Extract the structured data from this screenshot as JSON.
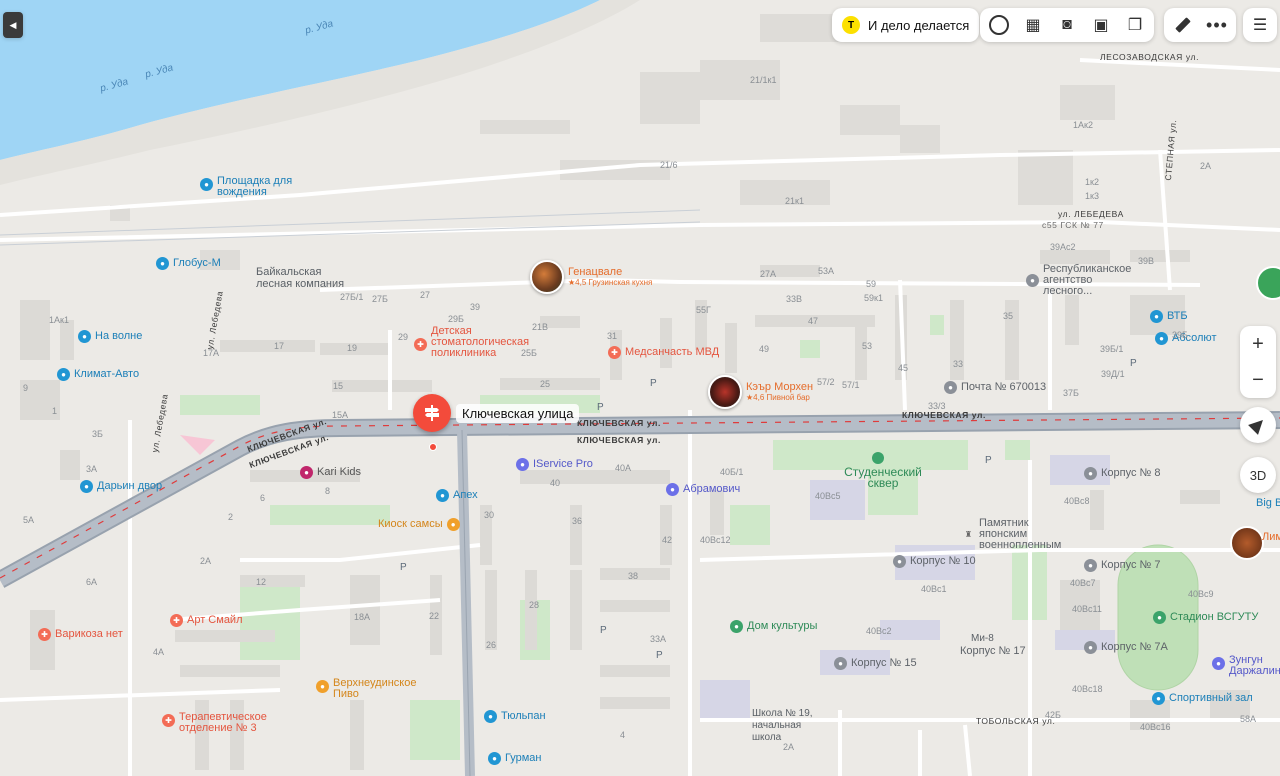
{
  "top_bar": {
    "promo_label": "И дело делается",
    "promo_icon": "taxi-logo-icon",
    "accent": "#fce000"
  },
  "river": {
    "label": "р. Уда"
  },
  "streets": {
    "klyuchevskaya": "КЛЮЧЕВСКАЯ ул.",
    "klyuchevskaya_left": "КЛЮЧЕВСКАЯ ул.",
    "lebedeva": "ул. Лебедева",
    "lebedeva_east": "ул. ЛЕБЕДЕВА",
    "lesozavodskaya": "ЛЕСОЗАВОДСКАЯ ул.",
    "stepnaya": "СТЕПНАЯ ул.",
    "tobolskaya": "ТОБОЛЬСКАЯ ул.",
    "gsk77": "с55 ГСК № 77"
  },
  "selected_place": {
    "title": "Ключевская улица",
    "color": "#f34b3b"
  },
  "pois": [
    {
      "name": "Площадка для вождения",
      "line2": "",
      "style": "blue",
      "icon": "⬤"
    },
    {
      "name": "Глобус-М",
      "style": "blue",
      "icon": "⬤"
    },
    {
      "name": "На волне",
      "style": "blue",
      "icon": "⬤"
    },
    {
      "name": "Климат-Авто",
      "style": "blue",
      "icon": "⬤"
    },
    {
      "name": "Дарьин двор",
      "style": "blue",
      "icon": "⬤"
    },
    {
      "name": "Kari Kids",
      "style": "magenta",
      "icon": "⬤"
    },
    {
      "name": "Апех",
      "style": "blue",
      "icon": "⬤"
    },
    {
      "name": "Киоск самсы",
      "style": "orange",
      "icon": "⬤"
    },
    {
      "name": "IService Pro",
      "style": "purple",
      "icon": "⬤"
    },
    {
      "name": "Абрамович",
      "style": "purple",
      "icon": "⬤"
    },
    {
      "name": "Медсанчасть МВД",
      "style": "red",
      "icon": "✚"
    },
    {
      "name": "Детская стоматологическая поликлиника",
      "style": "red",
      "icon": "✚"
    },
    {
      "name": "Арт Смайл",
      "style": "red",
      "icon": "✚"
    },
    {
      "name": "Варикоза нет",
      "style": "red",
      "icon": "✚"
    },
    {
      "name": "Терапевтическое отделение № 3",
      "style": "red",
      "icon": "✚"
    },
    {
      "name": "Верхнеудинское Пиво",
      "style": "orange",
      "icon": "⬤"
    },
    {
      "name": "Тюльпан",
      "style": "blue",
      "icon": "⬤"
    },
    {
      "name": "Гурман",
      "style": "blue",
      "icon": "⬤"
    },
    {
      "name": "Студенческий сквер",
      "style": "green",
      "icon": "⬤"
    },
    {
      "name": "Дом культуры",
      "style": "green",
      "icon": "⬤"
    },
    {
      "name": "Памятник японским военнопленным",
      "style": "gray",
      "icon": "⬤"
    },
    {
      "name": "Почта № 670013",
      "style": "gray",
      "icon": "⬤"
    },
    {
      "name": "Республиканское агентство лесного...",
      "style": "gray",
      "icon": "⬤"
    },
    {
      "name": "ВТБ",
      "style": "blue",
      "icon": "⬤"
    },
    {
      "name": "Абсолют",
      "style": "blue",
      "icon": "⬤"
    },
    {
      "name": "Стадион ВСГУТУ",
      "style": "green",
      "icon": "⬤"
    },
    {
      "name": "Спортивный зал",
      "style": "blue",
      "icon": "⬤"
    },
    {
      "name": "Зунгун Даржалинг",
      "style": "purple",
      "icon": "⬤"
    },
    {
      "name": "Байкальская лесная компания",
      "style": "gray",
      "icon": ""
    },
    {
      "name": "Корпус № 8",
      "style": "gray",
      "icon": "⬤"
    },
    {
      "name": "Корпус № 10",
      "style": "gray",
      "icon": "⬤"
    },
    {
      "name": "Корпус № 7",
      "style": "gray",
      "icon": "⬤"
    },
    {
      "name": "Корпус № 17",
      "style": "gray",
      "icon": "⬤"
    },
    {
      "name": "Корпус № 15",
      "style": "gray",
      "icon": "⬤"
    },
    {
      "name": "Корпус № 7А",
      "style": "gray",
      "icon": "⬤"
    },
    {
      "name": "Школа № 19, начальная школа",
      "style": "gray",
      "icon": ""
    },
    {
      "name": "Ми-8",
      "style": "gray",
      "icon": ""
    }
  ],
  "featured": [
    {
      "name": "Генацвале",
      "sub": "★4,5 Грузинская кухня"
    },
    {
      "name": "Кэър Морхен",
      "sub": "★4,6 Пивной бар"
    }
  ],
  "right_edge": {
    "bigbiz": "Big B",
    "lim": "Лим"
  },
  "house_numbers": [
    "21/1к1",
    "21/6",
    "21к1",
    "27Б/1",
    "27Б",
    "27",
    "29Б",
    "39",
    "21В",
    "25Б",
    "29",
    "31",
    "19",
    "17",
    "17А",
    "15",
    "15А",
    "25",
    "55Г",
    "33В",
    "27А",
    "53А",
    "59",
    "59к1",
    "47",
    "49",
    "53",
    "57/2",
    "57/1",
    "45",
    "33",
    "35",
    "33/3",
    "37Б",
    "39Б",
    "39Б/1",
    "39Д/1",
    "39Ас2",
    "39В",
    "1Ак1",
    "1Ак2",
    "1к2",
    "1к3",
    "2А",
    "40А",
    "40Б/1",
    "40",
    "36",
    "30",
    "42",
    "40Вс5",
    "40Вс12",
    "40Вс8",
    "40Вс7",
    "40Вс11",
    "40Вс9",
    "40Вс2",
    "40Вс1",
    "40Вс18",
    "40Вс16",
    "38",
    "33А",
    "28",
    "26",
    "22",
    "18А",
    "12",
    "8",
    "6",
    "2",
    "4А",
    "2А",
    "6А",
    "5А",
    "3Б",
    "3А",
    "58А",
    "42Б",
    "2А",
    "4",
    "9",
    "1"
  ],
  "map_controls": {
    "zoom_in": "+",
    "zoom_out": "−",
    "three_d": "3D"
  },
  "colors": {
    "water": "#9fd5f5",
    "land": "#eceae6",
    "building": "#dcdad6",
    "park": "#cfe8c9",
    "road_major": "#aab3bf",
    "road_minor": "#ffffff",
    "traffic_red": "#e03b3b"
  }
}
